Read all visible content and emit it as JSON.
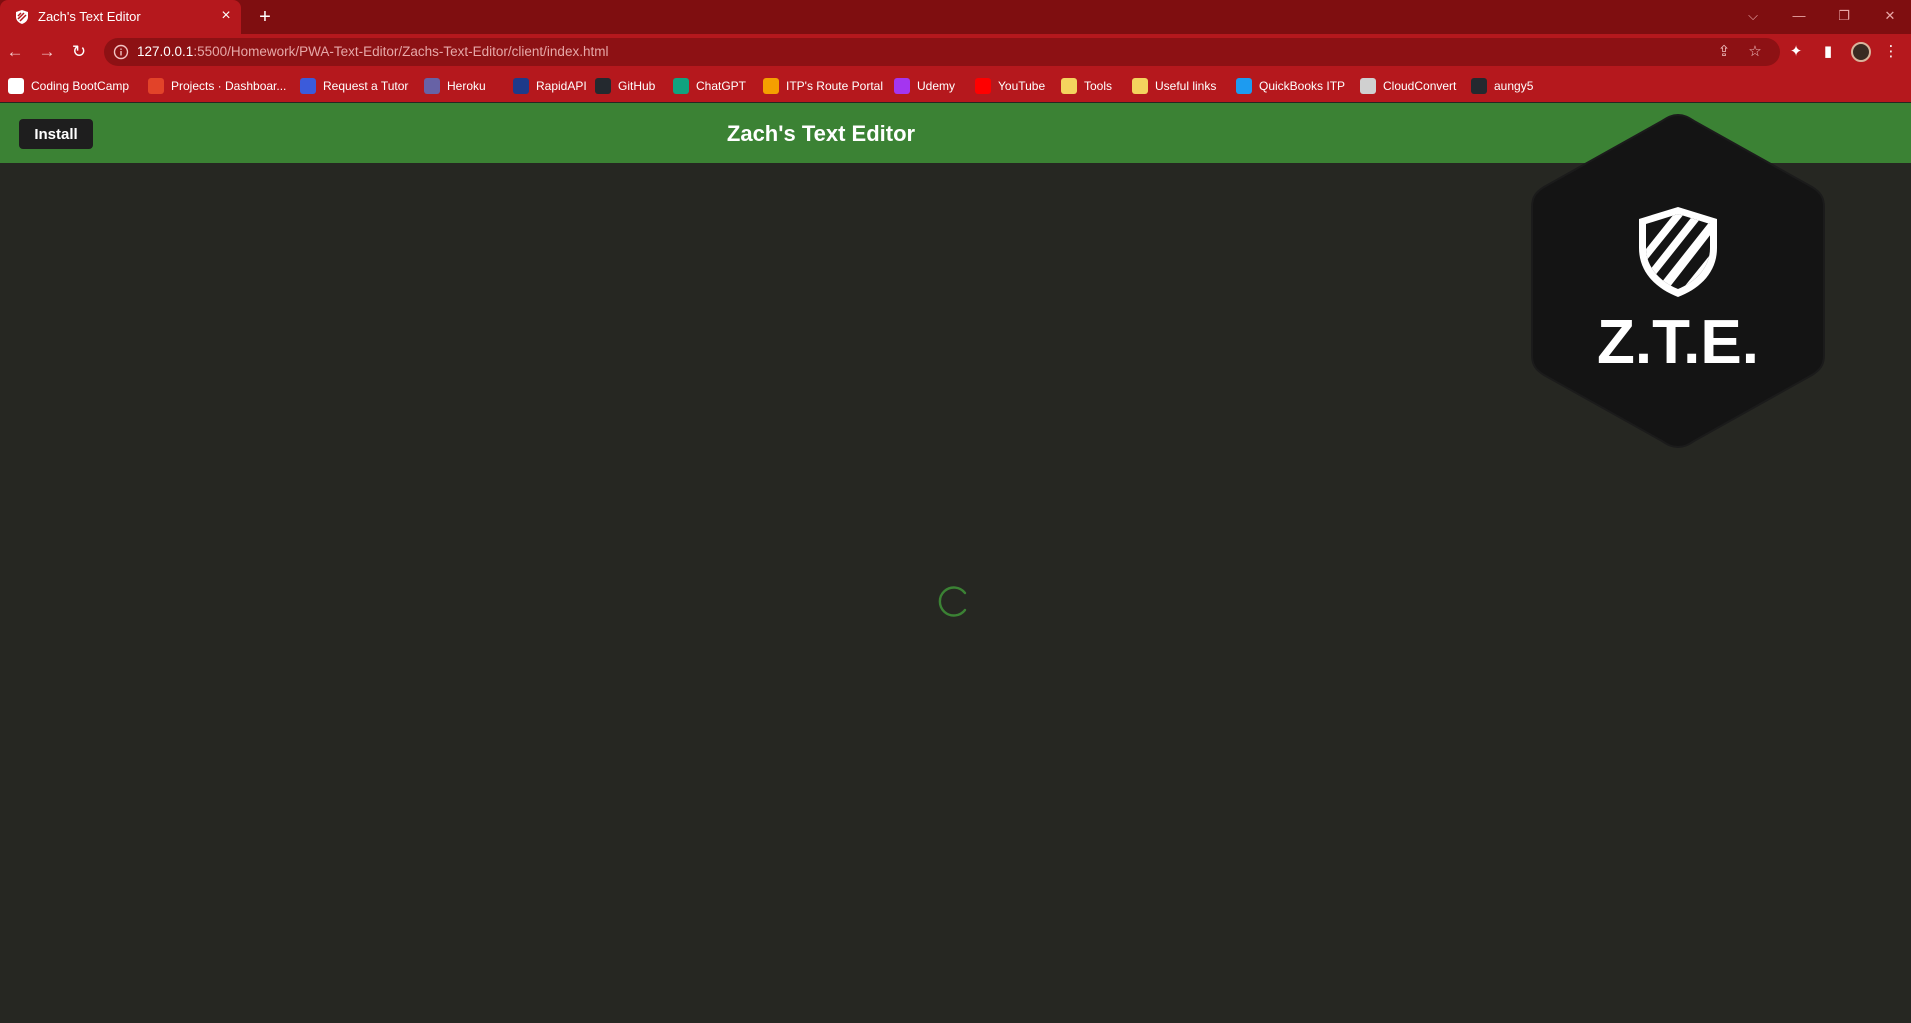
{
  "browser": {
    "tab": {
      "title": "Zach's Text Editor",
      "close_glyph": "×"
    },
    "new_tab_glyph": "+",
    "window_controls": {
      "dropdown": "⌵",
      "minimize": "—",
      "restore": "❐",
      "close": "✕"
    },
    "nav": {
      "back": "←",
      "forward": "→",
      "reload": "↻"
    },
    "url": {
      "host": "127.0.0.1",
      "path": ":5500/Homework/PWA-Text-Editor/Zachs-Text-Editor/client/index.html"
    },
    "toolbar_icons": [
      "share-icon",
      "bookmark-star-icon",
      "extensions-icon",
      "side-panel-icon",
      "profile-avatar",
      "menu-icon"
    ],
    "bookmarks": [
      {
        "label": "Coding BootCamp",
        "color": "#ffffff"
      },
      {
        "label": "Projects · Dashboar...",
        "color": "#e24329"
      },
      {
        "label": "Request a Tutor",
        "color": "#3b5bdb"
      },
      {
        "label": "Heroku",
        "color": "#6762a6"
      },
      {
        "label": "RapidAPI",
        "color": "#1e3a8a"
      },
      {
        "label": "GitHub",
        "color": "#24292f"
      },
      {
        "label": "ChatGPT",
        "color": "#10a37f"
      },
      {
        "label": "ITP's Route Portal",
        "color": "#f59f00"
      },
      {
        "label": "Udemy",
        "color": "#a435f0"
      },
      {
        "label": "YouTube",
        "color": "#ff0000"
      },
      {
        "label": "Tools",
        "color": "#f4d35e"
      },
      {
        "label": "Useful links",
        "color": "#f4d35e"
      },
      {
        "label": "QuickBooks ITP",
        "color": "#1d9bf0"
      },
      {
        "label": "CloudConvert",
        "color": "#d0d0d0"
      },
      {
        "label": "aungy5",
        "color": "#24292f"
      }
    ]
  },
  "page": {
    "install_label": "Install",
    "title": "Zach's Text Editor",
    "logo_text": "Z.T.E.",
    "spinner": "loading"
  },
  "colors": {
    "tabstrip": "#7f0e10",
    "chrome": "#b5181d",
    "header": "#3b8234",
    "page_bg": "#262722",
    "spinner": "#3b8234"
  }
}
